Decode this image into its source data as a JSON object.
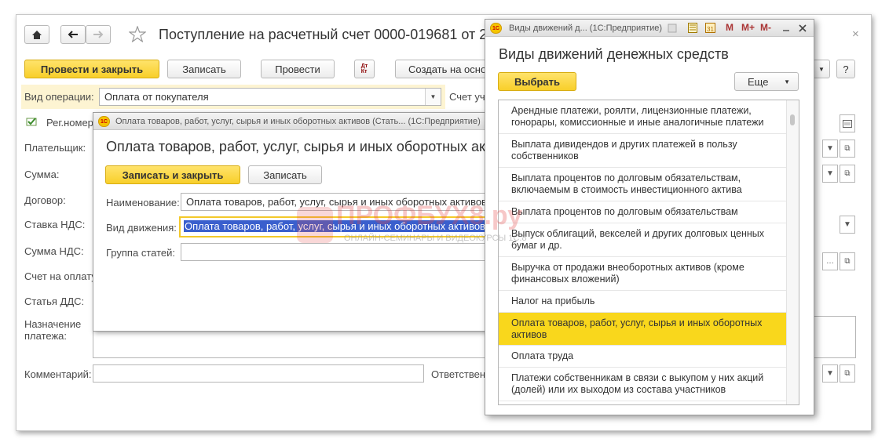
{
  "main": {
    "title": "Поступление на расчетный счет 0000-019681 от 2",
    "post_close": "Провести и закрыть",
    "write": "Записать",
    "post": "Провести",
    "dt_kt": "Дт\nКт",
    "create_basis": "Создать на осно",
    "more_q": "?",
    "op_type_label": "Вид операции:",
    "op_type_value": "Оплата от покупателя",
    "account_label": "Счет уч",
    "reg_label": "Рег.номер",
    "payer_label": "Плательщик:",
    "sum_label": "Сумма:",
    "contract_label": "Договор:",
    "vat_rate_label": "Ставка НДС:",
    "vat_sum_label": "Сумма НДС:",
    "invoice_label": "Счет на оплату",
    "dds_label": "Статья ДДС:",
    "purpose_label": "Назначение\nплатежа:",
    "comment_label": "Комментарий:",
    "responsible_label": "Ответственн",
    "close_x": "×"
  },
  "sub": {
    "window_title": "Оплата товаров, работ, услуг, сырья и иных оборотных активов (Стать...   (1С:Предприятие)",
    "heading": "Оплата товаров, работ, услуг, сырья и иных оборотных ак",
    "write_close": "Записать и закрыть",
    "write": "Записать",
    "name_label": "Наименование:",
    "name_value": "Оплата товаров, работ, услуг, сырья и иных оборотных активов",
    "move_label": "Вид движения:",
    "move_value": "Оплата товаров, работ, услуг, сырья и иных оборотных активов",
    "group_label": "Группа статей:"
  },
  "list": {
    "window_title": "Виды движений д...  (1С:Предприятие)",
    "tb_m": "M",
    "tb_mplus": "M+",
    "tb_mminus": "M-",
    "heading": "Виды движений денежных средств",
    "choose": "Выбрать",
    "more": "Еще",
    "items": [
      {
        "label": "Арендные платежи, роялти, лицензионные платежи, гонорары, комиссионные и иные аналогичные платежи"
      },
      {
        "label": "Выплата дивидендов и других платежей в пользу собственников"
      },
      {
        "label": "Выплата процентов по долговым обязательствам, включаемым в стоимость инвестиционного актива"
      },
      {
        "label": "Выплата процентов по долговым обязательствам"
      },
      {
        "label": "Выпуск облигаций, векселей и других долговых ценных бумаг и др."
      },
      {
        "label": "Выручка от продажи внеоборотных активов (кроме финансовых вложений)"
      },
      {
        "label": "Налог на прибыль"
      },
      {
        "label": "Оплата товаров, работ, услуг, сырья и иных оборотных активов"
      },
      {
        "label": "Оплата труда"
      },
      {
        "label": "Платежи собственникам в связи с выкупом у них акций (долей) или их выходом из состава участников"
      }
    ]
  },
  "watermark": {
    "brand": "ПРОФБУХ8.ру",
    "tagline": "ОНЛАЙН-СЕМИНАРЫ И ВИДЕОКУРСЫ 1С:8"
  },
  "colors": {
    "accent_yellow": "#f9d71c",
    "selection_blue": "#3a5fcd",
    "watermark_red": "#e34a4a"
  }
}
